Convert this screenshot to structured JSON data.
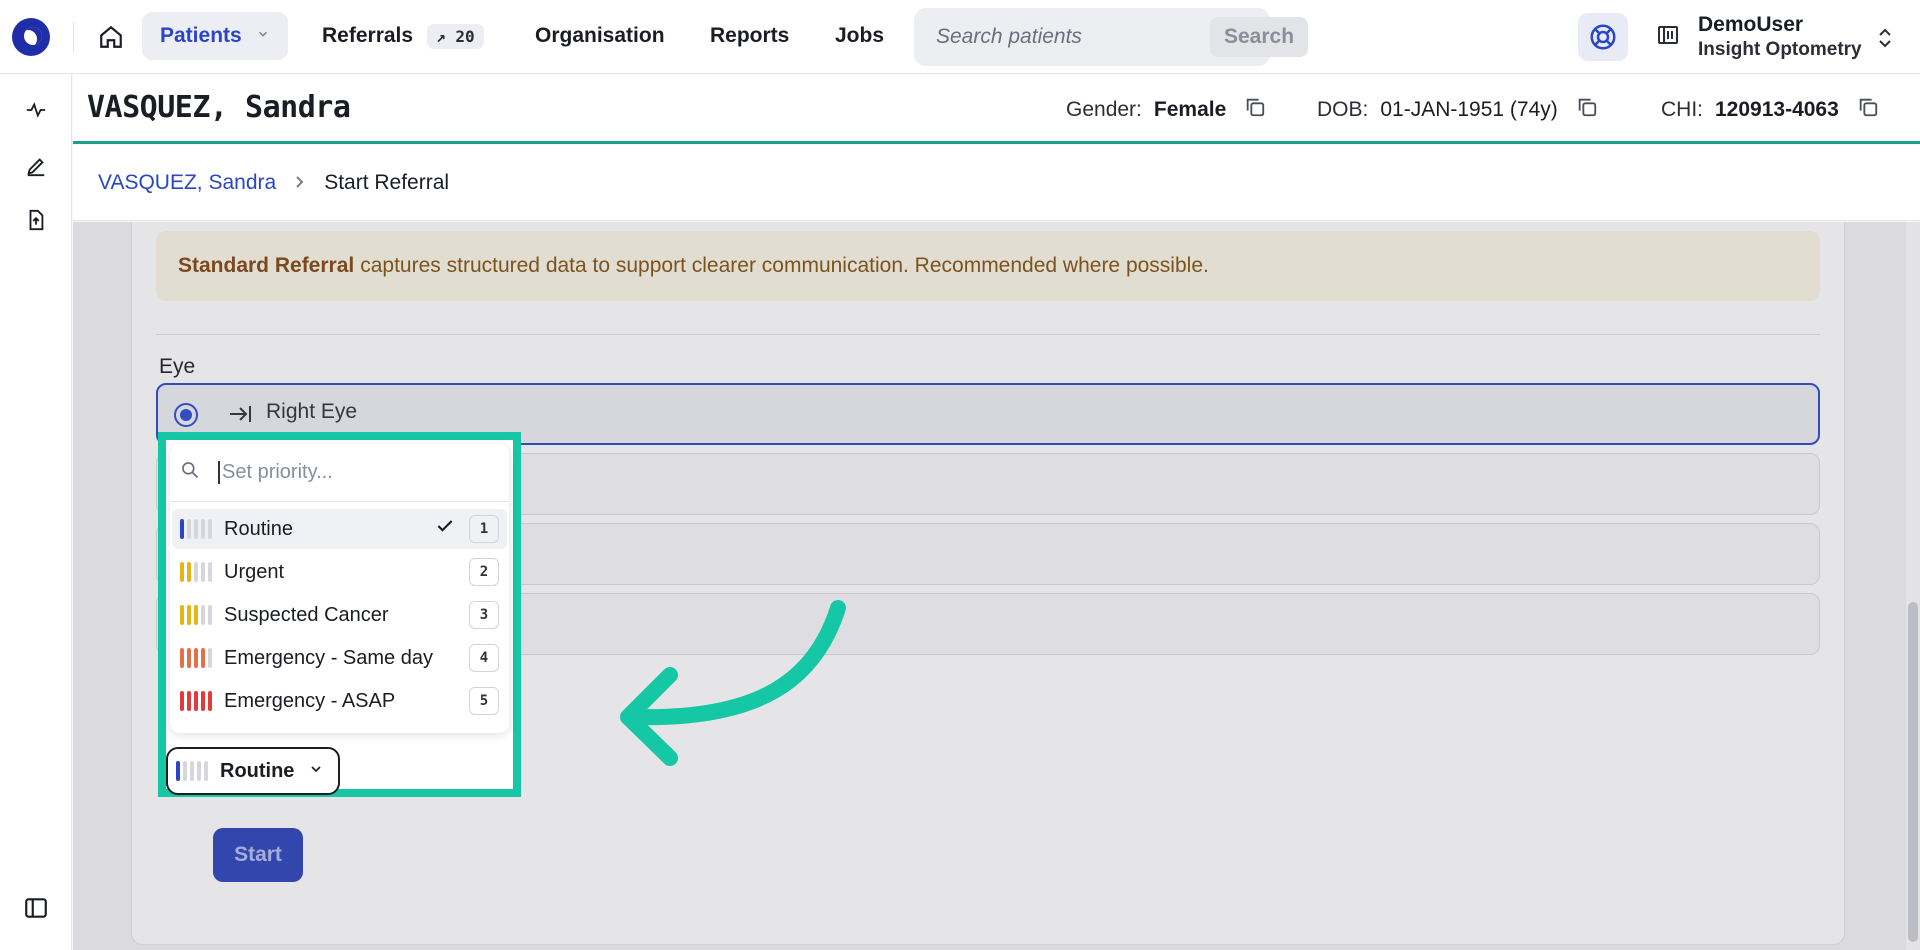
{
  "topbar": {
    "nav_patients": "Patients",
    "nav_referrals": "Referrals",
    "referrals_badge": "↗ 20",
    "nav_organisation": "Organisation",
    "nav_reports": "Reports",
    "nav_jobs": "Jobs",
    "search_placeholder": "Search patients",
    "search_button": "Search",
    "user_name": "DemoUser",
    "user_org": "Insight Optometry"
  },
  "patient": {
    "name": "VASQUEZ, Sandra",
    "gender_label": "Gender:",
    "gender_value": "Female",
    "dob_label": "DOB:",
    "dob_value": "01-JAN-1951 (74y)",
    "chi_label": "CHI:",
    "chi_value": "120913-4063"
  },
  "breadcrumb": {
    "patient_link": "VASQUEZ,  Sandra",
    "current": "Start Referral"
  },
  "form": {
    "notice_bold": "Standard Referral",
    "notice_text": "captures structured data to support clearer communication. Recommended where possible.",
    "eye_label": "Eye",
    "right_eye_option": "Right Eye",
    "start_button": "Start"
  },
  "priority_dropdown": {
    "placeholder": "Set priority...",
    "options": [
      {
        "label": "Routine",
        "key": "1",
        "selected": true,
        "level": 1,
        "color": "#2a46c6"
      },
      {
        "label": "Urgent",
        "key": "2",
        "selected": false,
        "level": 2,
        "color": "#e8b416"
      },
      {
        "label": "Suspected Cancer",
        "key": "3",
        "selected": false,
        "level": 3,
        "color": "#e8b416"
      },
      {
        "label": "Emergency - Same day",
        "key": "4",
        "selected": false,
        "level": 4,
        "color": "#e2714a"
      },
      {
        "label": "Emergency - ASAP",
        "key": "5",
        "selected": false,
        "level": 5,
        "color": "#e23b3b"
      }
    ],
    "current_value": "Routine"
  },
  "colors": {
    "accent": "#2a46c6",
    "highlight": "#15c7a4",
    "teal_rule": "#1b9e8a"
  }
}
